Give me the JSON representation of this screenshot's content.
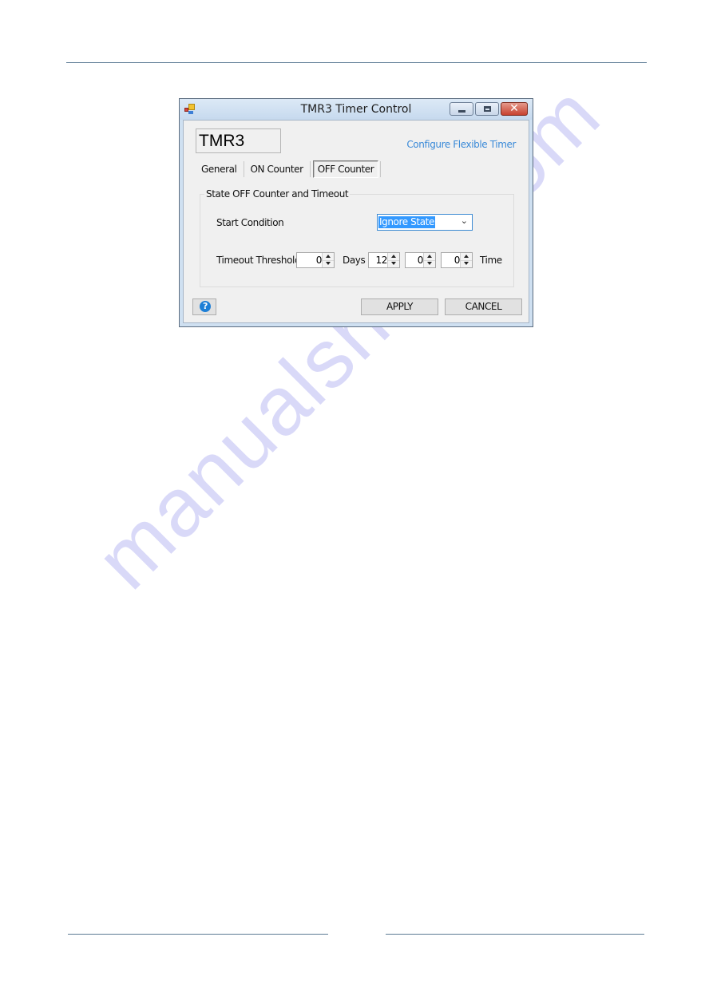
{
  "page": {
    "watermark": "manualshive.com"
  },
  "window": {
    "title": "TMR3 Timer Control",
    "icons": {
      "app": "app-icon",
      "minimize": "minimize-icon",
      "maximize": "maximize-icon",
      "close": "close-icon"
    },
    "close_glyph": "✕"
  },
  "dialog": {
    "timer_name": "TMR3",
    "configure_link": "Configure Flexible Timer",
    "tabs": [
      {
        "label": "General",
        "active": false
      },
      {
        "label": "ON Counter",
        "active": false
      },
      {
        "label": "OFF Counter",
        "active": true
      }
    ],
    "group": {
      "title": "State OFF Counter and Timeout",
      "start_condition_label": "Start Condition",
      "start_condition_value": "Ignore State",
      "timeout_label": "Timeout Threshold",
      "days_value": "0",
      "days_label": "Days",
      "hours_value": "12",
      "minutes_value": "0",
      "seconds_value": "0",
      "time_label": "Time"
    },
    "buttons": {
      "help_glyph": "?",
      "apply": "APPLY",
      "cancel": "CANCEL"
    }
  }
}
